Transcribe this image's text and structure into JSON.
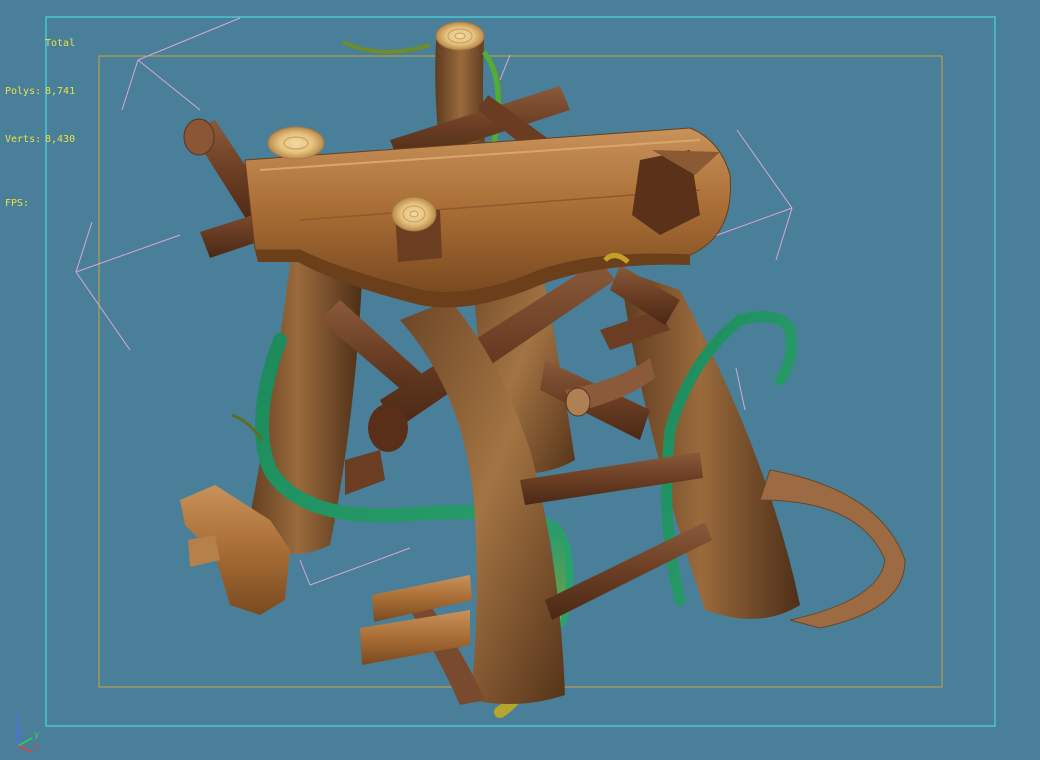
{
  "viewport": {
    "stats": {
      "header": "Total",
      "polys_label": "Polys:",
      "polys_value": "8,741",
      "verts_label": "Verts:",
      "verts_value": "8,430",
      "fps_label": "FPS:"
    },
    "axis": {
      "z": "z",
      "y": "y",
      "x": "x"
    },
    "colors": {
      "background": "#4a7f99",
      "stats_text": "#e6e34a",
      "viewport_border": "#49c5d3",
      "safe_frame": "#c9a53e",
      "selection_bracket": "#d8a8d4"
    }
  }
}
